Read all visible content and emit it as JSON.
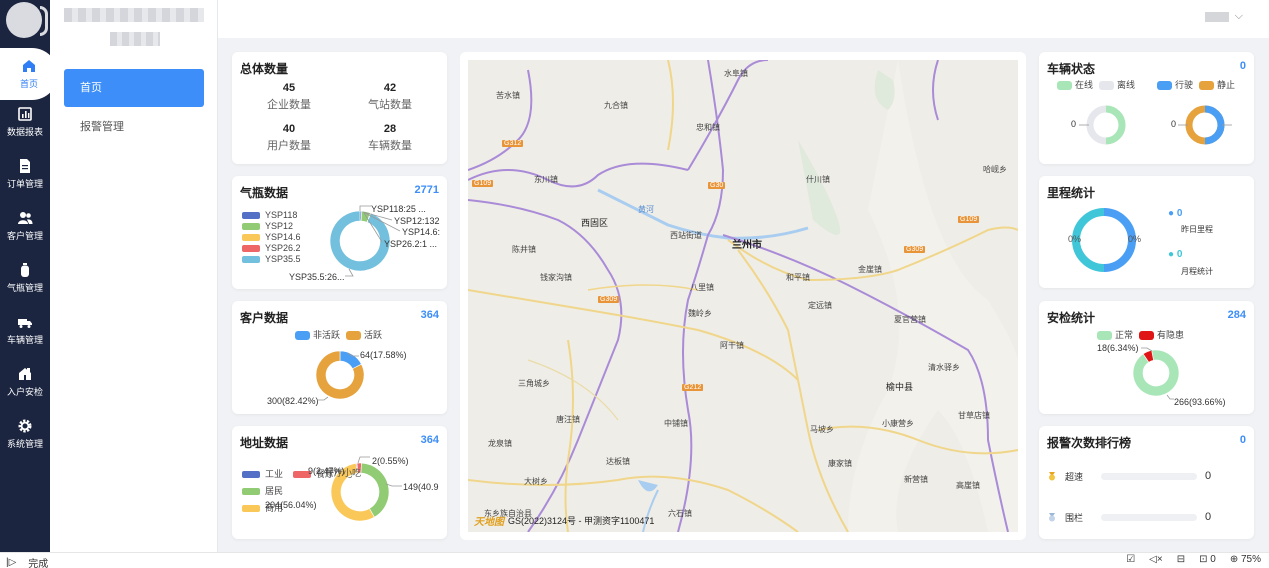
{
  "nav": {
    "items": [
      {
        "label": "首页",
        "icon": "home-icon"
      },
      {
        "label": "数据报表",
        "icon": "report-icon"
      },
      {
        "label": "订单管理",
        "icon": "order-icon"
      },
      {
        "label": "客户管理",
        "icon": "customer-icon"
      },
      {
        "label": "气瓶管理",
        "icon": "cylinder-icon"
      },
      {
        "label": "车辆管理",
        "icon": "truck-icon"
      },
      {
        "label": "入户安检",
        "icon": "inspection-icon"
      },
      {
        "label": "系统管理",
        "icon": "gear-icon"
      }
    ]
  },
  "submenu": {
    "items": [
      "首页",
      "报警管理"
    ]
  },
  "totals": {
    "title": "总体数量",
    "stats": [
      {
        "value": "45",
        "label": "企业数量"
      },
      {
        "value": "42",
        "label": "气站数量"
      },
      {
        "value": "40",
        "label": "用户数量"
      },
      {
        "value": "28",
        "label": "车辆数量"
      }
    ]
  },
  "cylinder": {
    "title": "气瓶数据",
    "count": "2771",
    "labels": [
      "YSP118:25 ...",
      "YSP12:132",
      "YSP14.6:",
      "YSP26.2:1 ...",
      "YSP35.5:26..."
    ]
  },
  "customer": {
    "title": "客户数据",
    "count": "364",
    "labels": [
      "64(17.58%)",
      "300(82.42%)"
    ]
  },
  "address": {
    "title": "地址数据",
    "count": "364",
    "labels": [
      "9(2.47%)",
      "2(0.55%)",
      "149(40.9",
      "204(56.04%)"
    ],
    "overlap_label": "餐厅小吃"
  },
  "vehicle": {
    "title": "车辆状态",
    "count": "0",
    "legend": [
      "在线",
      "离线",
      "行驶",
      "静止"
    ],
    "left_value": "0",
    "right_value": "0"
  },
  "mileage": {
    "title": "里程统计",
    "center_left": "0%",
    "center_right": "0%",
    "items": [
      {
        "value": "0",
        "label": "昨日里程"
      },
      {
        "value": "0",
        "label": "月程统计"
      }
    ]
  },
  "safety": {
    "title": "安检统计",
    "count": "284",
    "legend": [
      "正常",
      "有隐患"
    ],
    "labels": [
      "18(6.34%)",
      "266(93.66%)"
    ]
  },
  "alarm": {
    "title": "报警次数排行榜",
    "count": "0",
    "rows": [
      {
        "label": "超速",
        "value": "0"
      },
      {
        "label": "围栏",
        "value": "0"
      }
    ]
  },
  "map": {
    "city": "兰州市",
    "labels": [
      "水阜镇",
      "九合镇",
      "苦水镇",
      "忠和镇",
      "东川镇",
      "什川镇",
      "哈岘乡",
      "西固区",
      "西站街道",
      "陈井镇",
      "钱家沟镇",
      "和平镇",
      "金崖镇",
      "八里镇",
      "定远镇",
      "魏岭乡",
      "夏官营镇",
      "阿干镇",
      "榆中县",
      "清水驿乡",
      "甘草店镇",
      "马坡乡",
      "小康营乡",
      "唐汪镇",
      "龙泉镇",
      "中铺镇",
      "达板镇",
      "大树乡",
      "新营镇",
      "高崖镇",
      "三角城乡",
      "康家镇",
      "六石镇",
      "东乡族自治县"
    ],
    "roads": [
      "G312",
      "G109",
      "G30",
      "G309",
      "G212",
      "G109",
      "G309"
    ],
    "river": "黄河",
    "logo": "天地图",
    "credit": "GS(2022)3124号 - 甲测资字1100471"
  },
  "chart_data": [
    {
      "type": "pie",
      "title": "气瓶数据",
      "categories": [
        "YSP118",
        "YSP12",
        "YSP14.6",
        "YSP26.2",
        "YSP35.5"
      ],
      "values": [
        25,
        132,
        6,
        1,
        2607
      ],
      "colors": [
        "#5470c6",
        "#91cc75",
        "#fac858",
        "#ee6666",
        "#73c0de"
      ]
    },
    {
      "type": "pie",
      "title": "客户数据",
      "categories": [
        "非活跃",
        "活跃"
      ],
      "values": [
        64,
        300
      ],
      "colors": [
        "#4a9ff5",
        "#e6a23c"
      ]
    },
    {
      "type": "pie",
      "title": "地址数据",
      "categories": [
        "工业",
        "餐厅小吃",
        "居民",
        "商用"
      ],
      "values": [
        2,
        9,
        149,
        204
      ],
      "colors": [
        "#5470c6",
        "#ee6666",
        "#91cc75",
        "#fac858"
      ]
    },
    {
      "type": "pie",
      "title": "安检统计",
      "categories": [
        "正常",
        "有隐患"
      ],
      "values": [
        266,
        18
      ],
      "colors": [
        "#a8e6b8",
        "#e01515"
      ]
    }
  ],
  "legends": {
    "cylinder": [
      "YSP118",
      "YSP12",
      "YSP14.6",
      "YSP26.2",
      "YSP35.5"
    ],
    "customer": [
      "非活跃",
      "活跃"
    ],
    "address": [
      "工业",
      "餐厅小吃",
      "居民",
      "商用"
    ]
  },
  "statusbar": {
    "left": "完成",
    "count": "0",
    "zoom": "75%"
  }
}
